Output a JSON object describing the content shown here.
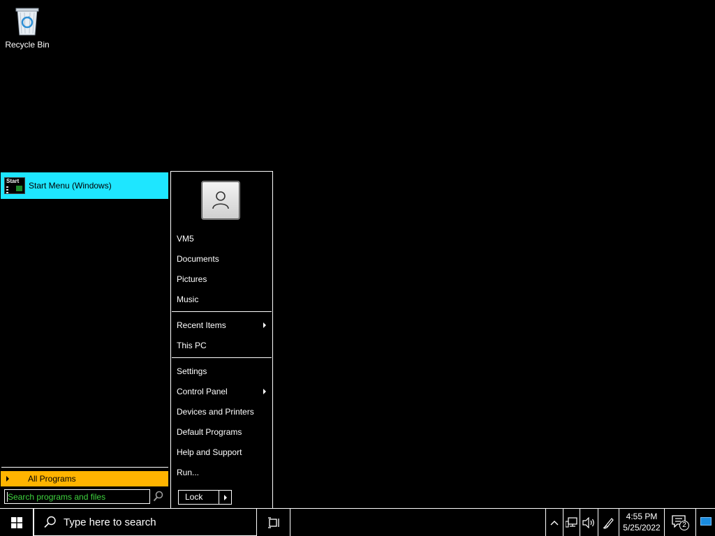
{
  "desktop": {
    "icons": [
      {
        "label": "Recycle Bin",
        "icon": "recycle-bin-icon"
      }
    ]
  },
  "start_menu": {
    "pinned": [
      {
        "label": "Start Menu (Windows)",
        "icon_text": "Start",
        "icon": "start-menu-app-icon"
      }
    ],
    "all_programs_label": "All Programs",
    "search_placeholder": "Search programs and files",
    "right_items": [
      {
        "label": "VM5"
      },
      {
        "label": "Documents"
      },
      {
        "label": "Pictures"
      },
      {
        "label": "Music"
      },
      {
        "label": "Recent Items",
        "submenu": true
      },
      {
        "label": "This PC"
      },
      {
        "label": "Settings"
      },
      {
        "label": "Control Panel",
        "submenu": true
      },
      {
        "label": "Devices and Printers"
      },
      {
        "label": "Default Programs"
      },
      {
        "label": "Help and Support"
      },
      {
        "label": "Run..."
      }
    ],
    "lock_label": "Lock",
    "colors": {
      "pinned_highlight": "#1ee6ff",
      "all_programs_bg": "#ffb400",
      "search_text": "#3fd43f"
    }
  },
  "taskbar": {
    "search_placeholder": "Type here to search",
    "clock_time": "4:55 PM",
    "clock_date": "5/25/2022",
    "notification_count": "2"
  }
}
